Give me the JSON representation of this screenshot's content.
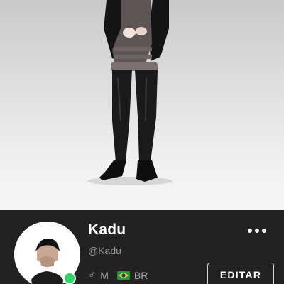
{
  "profile": {
    "username": "Kadu",
    "handle": "@Kadu",
    "gender_symbol": "♂",
    "gender_label": "M",
    "country_code": "BR",
    "online_status_color": "#2bd66a",
    "edit_button_label": "EDITAR"
  },
  "icons": {
    "more": "more-horizontal-icon",
    "gender": "male-icon",
    "flag": "brazil-flag-icon",
    "status": "online-indicator"
  },
  "colors": {
    "profile_background": "#222222",
    "scene_background": "#e6e6e6",
    "online": "#2bd66a"
  }
}
